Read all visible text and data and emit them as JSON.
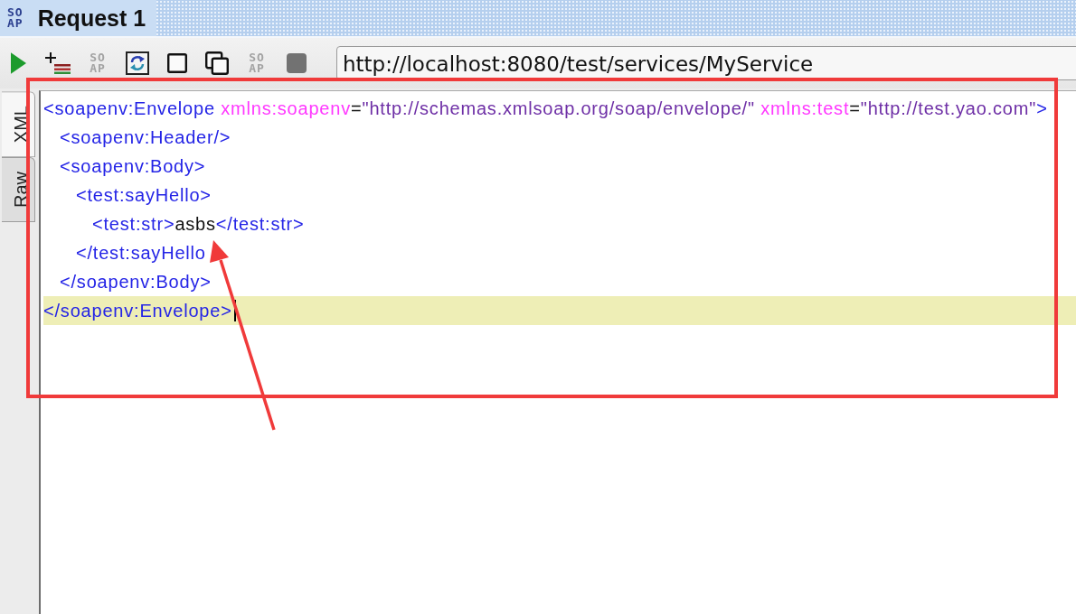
{
  "tab": {
    "icon_text": [
      "SO",
      "AP"
    ],
    "title": "Request 1"
  },
  "toolbar": {
    "buttons": [
      {
        "kind": "run",
        "disabled": false
      },
      {
        "kind": "add-step",
        "disabled": false
      },
      {
        "kind": "soap",
        "disabled": true,
        "icon_text": [
          "SO",
          "AP"
        ]
      },
      {
        "kind": "format",
        "disabled": false
      },
      {
        "kind": "square",
        "disabled": false
      },
      {
        "kind": "copy",
        "disabled": false
      },
      {
        "kind": "soap",
        "disabled": true,
        "icon_text": [
          "SO",
          "AP"
        ]
      },
      {
        "kind": "stop",
        "disabled": true
      }
    ],
    "endpoint": {
      "value": "http://localhost:8080/test/services/MyService"
    }
  },
  "editor": {
    "view_tabs": [
      {
        "label": "XML",
        "selected": true
      },
      {
        "label": "Raw",
        "selected": false
      }
    ],
    "lines": [
      {
        "tokens": [
          {
            "kind": "tag",
            "text": "<soapenv:Envelope"
          },
          {
            "kind": "attr",
            "text": " xmlns:soapenv"
          },
          {
            "kind": "punct",
            "text": "="
          },
          {
            "kind": "value",
            "text": "\"http://schemas.xmlsoap.org/soap/envelope/\""
          },
          {
            "kind": "attr",
            "text": " xmlns:test"
          },
          {
            "kind": "punct",
            "text": "="
          },
          {
            "kind": "value",
            "text": "\"http://test.yao.com\""
          },
          {
            "kind": "tag",
            "text": ">"
          }
        ],
        "current": false,
        "children": [
          {
            "tokens": [
              {
                "kind": "tag",
                "text": "<soapenv:Header/>"
              }
            ],
            "current": false
          },
          {
            "tokens": [
              {
                "kind": "tag",
                "text": "<soapenv:Body>"
              }
            ],
            "current": false,
            "children": [
              {
                "tokens": [
                  {
                    "kind": "tag",
                    "text": "<test:sayHello>"
                  }
                ],
                "current": false,
                "children": [
                  {
                    "tokens": [
                      {
                        "kind": "tag",
                        "text": "<test:str>"
                      },
                      {
                        "kind": "text",
                        "text": "asbs"
                      },
                      {
                        "kind": "tag",
                        "text": "</test:str>"
                      }
                    ],
                    "current": false
                  }
                ]
              },
              {
                "tokens": [
                  {
                    "kind": "tag",
                    "text": "</test:sayHello"
                  }
                ],
                "current": false
              }
            ]
          },
          {
            "tokens": [
              {
                "kind": "tag",
                "text": "</soapenv:Body>"
              }
            ],
            "current": false
          }
        ]
      },
      {
        "tokens": [
          {
            "kind": "tag",
            "text": "</soapenv:Envelope>"
          }
        ],
        "current": true
      }
    ]
  },
  "annotations": {
    "highlight_frame": true,
    "pointer_arrow": true
  }
}
